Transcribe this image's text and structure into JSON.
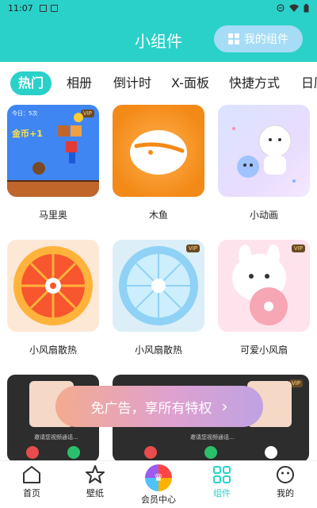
{
  "status_bar": {
    "time": "11:07"
  },
  "header": {
    "title": "小组件",
    "my_widgets_label": "我的组件"
  },
  "tabs": [
    "热门",
    "相册",
    "倒计时",
    "X-面板",
    "快捷方式",
    "日历"
  ],
  "widgets": [
    {
      "label": "马里奥",
      "vip": true,
      "overlay_text": "今日：5次",
      "coin_text": "金币+1"
    },
    {
      "label": "木鱼",
      "vip": false
    },
    {
      "label": "小动画",
      "vip": false
    },
    {
      "label": "小风扇散热",
      "vip": false
    },
    {
      "label": "小风扇散热",
      "vip": true
    },
    {
      "label": "可爱小风扇",
      "vip": true
    }
  ],
  "video_cards": {
    "call_text": "邀请您视频通话...",
    "vip_label": "VIP"
  },
  "promo": {
    "text": "免广告，享所有特权",
    "arrow": "›"
  },
  "bottom_nav": [
    {
      "label": "首页",
      "icon": "home-icon"
    },
    {
      "label": "壁纸",
      "icon": "star-icon"
    },
    {
      "label": "会员中心",
      "icon": "crown-icon"
    },
    {
      "label": "组件",
      "icon": "widget-grid-icon"
    },
    {
      "label": "我的",
      "icon": "smiley-icon"
    }
  ],
  "colors": {
    "accent": "#2ad1c9",
    "promo_start": "#f3ab8f",
    "promo_end": "#bfa2e2"
  }
}
